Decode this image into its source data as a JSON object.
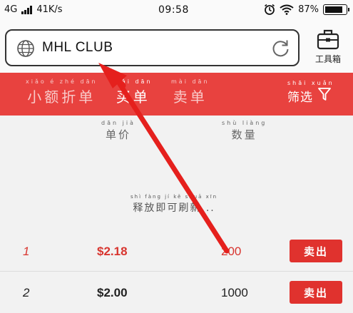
{
  "status_bar": {
    "network": "4G",
    "speed": "41K/s",
    "time": "09:58",
    "battery": "87%",
    "battery_level": 0.87
  },
  "address_bar": {
    "url": "MHL CLUB"
  },
  "toolbox": {
    "label": "工具箱"
  },
  "tabs": [
    {
      "pinyin": "xiǎo é zhé dān",
      "label": "小额折单"
    },
    {
      "pinyin": "mǎi dān",
      "label": "买单"
    },
    {
      "pinyin": "mài dān",
      "label": "卖单"
    }
  ],
  "filter": {
    "pinyin": "shāi xuǎn",
    "label": "筛选"
  },
  "columns": {
    "price": {
      "pinyin": "dān jià",
      "label": "单价"
    },
    "quantity": {
      "pinyin": "shù liàng",
      "label": "数量"
    }
  },
  "pull_refresh": {
    "pinyin": "shì fàng jí kě shuā xīn",
    "label": "释放即可刷新..."
  },
  "rows": [
    {
      "index": "1",
      "price": "$2.18",
      "quantity": "200",
      "action": "卖出"
    },
    {
      "index": "2",
      "price": "$2.00",
      "quantity": "1000",
      "action": "卖出"
    }
  ],
  "colors": {
    "accent": "#e8423f",
    "sell_button": "#e0322e",
    "highlight_row": "#d8352f"
  }
}
